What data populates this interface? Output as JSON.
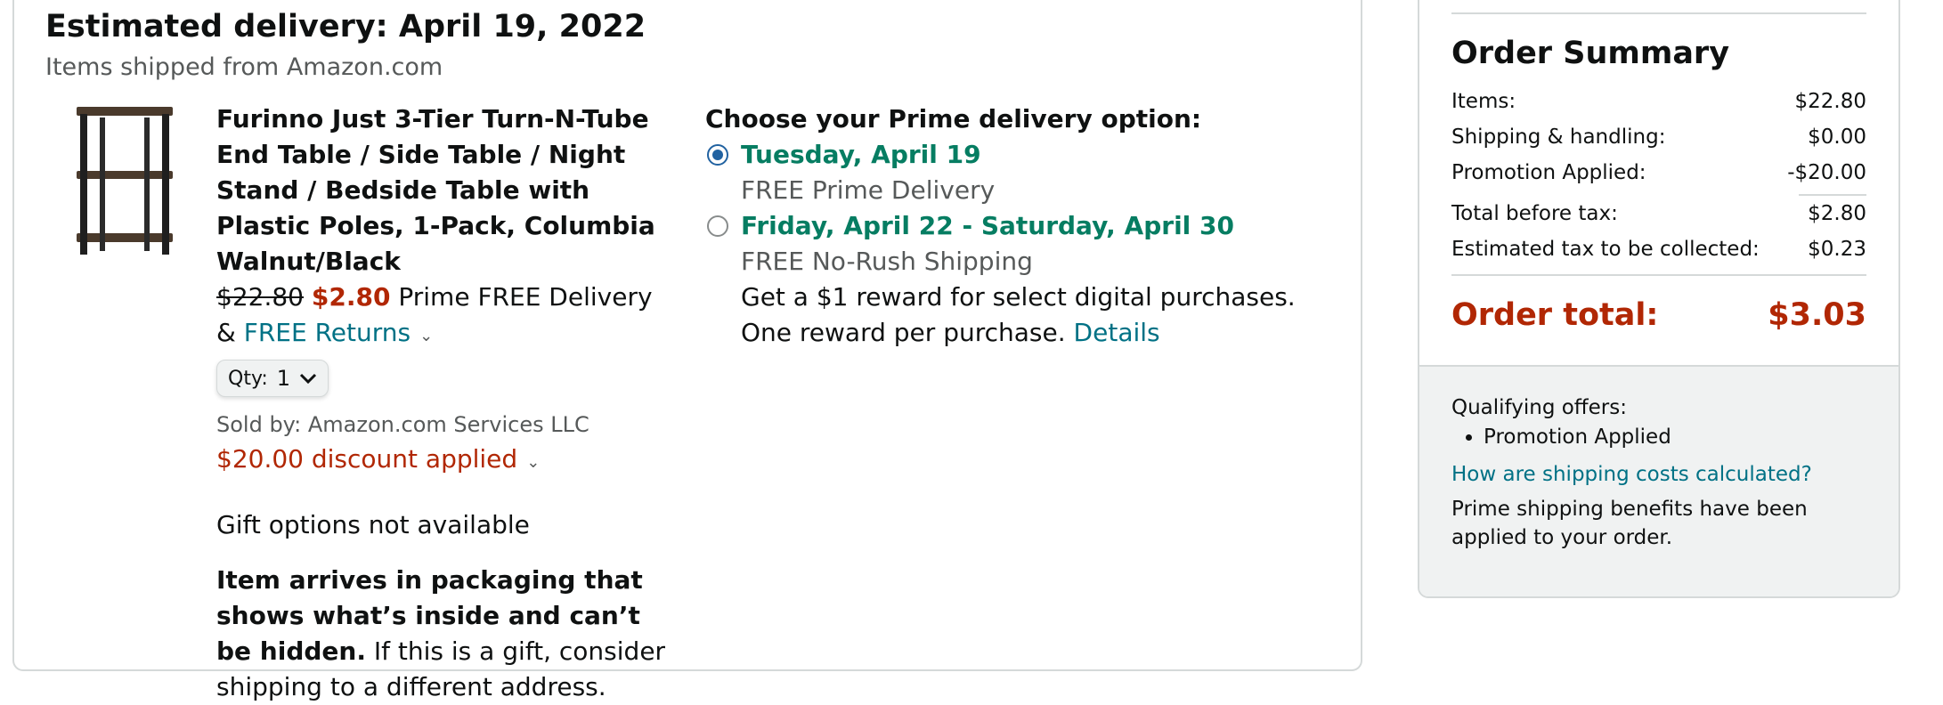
{
  "shipment": {
    "title": "Estimated delivery: April 19, 2022",
    "subtitle": "Items shipped from Amazon.com"
  },
  "product": {
    "title": "Furinno Just 3-Tier Turn-N-Tube End Table / Side Table / Night Stand / Bedside Table with Plastic Poles, 1-Pack, Columbia Walnut/Black",
    "original_price": "$22.80",
    "price": "$2.80",
    "delivery_text": "Prime FREE Delivery",
    "amp": "&",
    "returns_label": "FREE Returns",
    "qty_label": "Qty:",
    "qty_value": "1",
    "sold_by_label": "Sold by:",
    "sold_by_value": "Amazon.com Services LLC",
    "discount_text": "$20.00 discount applied",
    "gift_text": "Gift options not available",
    "packaging_bold": "Item arrives in packaging that shows what’s inside and can’t be hidden.",
    "packaging_rest": " If this is a gift, consider shipping to a different address."
  },
  "delivery_options": {
    "heading": "Choose your Prime delivery option:",
    "options": [
      {
        "date": "Tuesday, April 19",
        "desc": "FREE Prime Delivery",
        "selected": true
      },
      {
        "date": "Friday, April 22 - Saturday, April 30",
        "desc": "FREE No-Rush Shipping",
        "selected": false
      }
    ],
    "reward_text": "Get a $1 reward for select digital purchases. One reward per purchase.",
    "details_link": "Details"
  },
  "order_summary": {
    "title": "Order Summary",
    "items_label": "Items:",
    "items_value": "$22.80",
    "shipping_label": "Shipping & handling:",
    "shipping_value": "$0.00",
    "promo_label": "Promotion Applied:",
    "promo_value": "-$20.00",
    "before_tax_label": "Total before tax:",
    "before_tax_value": "$2.80",
    "tax_label": "Estimated tax to be collected:",
    "tax_value": "$0.23",
    "total_label": "Order total:",
    "total_value": "$3.03",
    "qualifying_label": "Qualifying offers:",
    "qualifying_items": [
      "Promotion Applied"
    ],
    "shipping_costs_link": "How are shipping costs calculated?",
    "benefits_text": "Prime shipping benefits have been applied to your order."
  },
  "colors": {
    "price_red": "#b12704",
    "delivery_green": "#067d62",
    "link_teal": "#007185",
    "radio_blue": "#2162a1"
  }
}
